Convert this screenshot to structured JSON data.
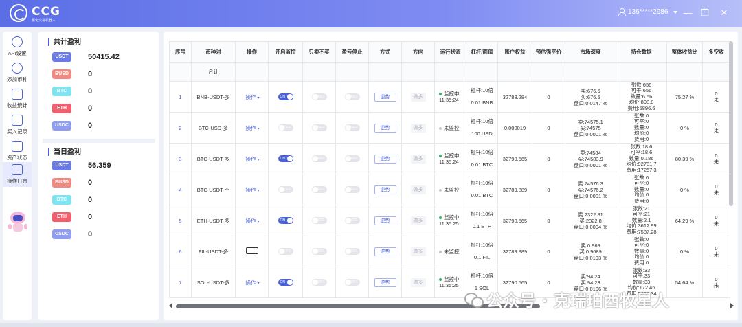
{
  "header": {
    "logo_text": "CCG",
    "logo_sub": "量化交易机器人",
    "user": "136*****2986",
    "window": {
      "minimize": "—",
      "restore": "❐",
      "close": "✕"
    }
  },
  "sidebar": {
    "items": [
      {
        "label": "API设置",
        "icon": "gear-icon"
      },
      {
        "label": "添加币种",
        "icon": "add-coin-icon"
      },
      {
        "label": "收益统计",
        "icon": "chart-icon"
      },
      {
        "label": "买入记录",
        "icon": "record-icon"
      },
      {
        "label": "资产状态",
        "icon": "wallet-icon"
      },
      {
        "label": "操作日志",
        "icon": "log-icon"
      }
    ]
  },
  "profit": {
    "total_title": "共计盈利",
    "today_title": "当日盈利",
    "total": [
      {
        "coin": "USDT",
        "value": "50415.42",
        "color": "#6a7be8"
      },
      {
        "coin": "BUSD",
        "value": "0",
        "color": "#f08a80"
      },
      {
        "coin": "BTC",
        "value": "0",
        "color": "#7fe3f0"
      },
      {
        "coin": "ETH",
        "value": "0",
        "color": "#f05f6e"
      },
      {
        "coin": "USDC",
        "value": "0",
        "color": "#8f9cf0"
      }
    ],
    "today": [
      {
        "coin": "USDT",
        "value": "56.359",
        "color": "#6a7be8"
      },
      {
        "coin": "BUSD",
        "value": "0",
        "color": "#f08a80"
      },
      {
        "coin": "BTC",
        "value": "0",
        "color": "#7fe3f0"
      },
      {
        "coin": "ETH",
        "value": "0",
        "color": "#f05f6e"
      },
      {
        "coin": "USDC",
        "value": "0",
        "color": "#8f9cf0"
      }
    ]
  },
  "table": {
    "headers": [
      "序号",
      "币种对",
      "操作",
      "开启监控",
      "只卖不买",
      "盈亏停止",
      "方式",
      "方向",
      "运行状态",
      "杠杆/面值",
      "账户权益",
      "预估强平价",
      "市场深度",
      "持仓数据",
      "整体收益比",
      "多空收"
    ],
    "summary_label": "合计",
    "rows": [
      {
        "idx": "1",
        "pair": "BNB-USDT-多",
        "op": "操作",
        "monitor": "ON",
        "sell_only": "OFF",
        "stop": "OFF",
        "mode": "逆势",
        "dir": "做多",
        "status": "监控中",
        "status_time": "11:35:24",
        "running": true,
        "lev": "杠杆:10倍",
        "face": "0.01 BNB",
        "equity": "32788.284",
        "liq": "0",
        "depth": [
          "卖:676.6",
          "买:676.5",
          "盘口:0.0147 %"
        ],
        "pos": [
          "张数:656",
          "可平:656",
          "数量:6.56",
          "均价:898.8",
          "费用:5896.6"
        ],
        "ratio": "75.27 %",
        "ls": [
          "0",
          "未"
        ]
      },
      {
        "idx": "2",
        "pair": "BTC-USD-多",
        "op": "操作",
        "monitor": "OFF",
        "sell_only": "OFF",
        "stop": "OFF",
        "mode": "逆势",
        "dir": "做多",
        "status": "未监控",
        "status_time": "",
        "running": false,
        "lev": "杠杆:10倍",
        "face": "100 USD",
        "equity": "0.000019",
        "liq": "0",
        "depth": [
          "卖:74575.1",
          "买:74575",
          "盘口:0.0001 %"
        ],
        "pos": [
          "张数:0",
          "可平:0",
          "数量:0",
          "均价:0",
          "费用:0"
        ],
        "ratio": "0 %",
        "ls": [
          "0",
          "未"
        ]
      },
      {
        "idx": "3",
        "pair": "BTC-USDT-多",
        "op": "操作",
        "monitor": "ON",
        "sell_only": "OFF",
        "stop": "OFF",
        "mode": "逆势",
        "dir": "做多",
        "status": "监控中",
        "status_time": "11:35:24",
        "running": true,
        "lev": "杠杆:10倍",
        "face": "0.01 BTC",
        "equity": "32790.565",
        "liq": "0",
        "depth": [
          "卖:74584",
          "买:74583.9",
          "盘口:0.0001 %"
        ],
        "pos": [
          "张数:18.6",
          "可平:18.6",
          "数量:0.186",
          "均价:92781.7",
          "费用:17257.3"
        ],
        "ratio": "80.39 %",
        "ls": [
          "0",
          "未"
        ]
      },
      {
        "idx": "4",
        "pair": "BTC-USDT-空",
        "op": "操作",
        "monitor": "OFF",
        "sell_only": "OFF",
        "stop": "OFF",
        "mode": "逆势",
        "dir": "做多",
        "status": "未监控",
        "status_time": "",
        "running": false,
        "lev": "杠杆:10倍",
        "face": "0.01 BTC",
        "equity": "32789.889",
        "liq": "0",
        "depth": [
          "卖:74576.3",
          "买:74576.2",
          "盘口:0.0001 %"
        ],
        "pos": [
          "张数:0",
          "可平:0",
          "数量:0",
          "均价:0",
          "费用:0"
        ],
        "ratio": "0 %",
        "ls": [
          "0",
          "未"
        ]
      },
      {
        "idx": "5",
        "pair": "ETH-USDT-多",
        "op": "操作",
        "monitor": "ON",
        "sell_only": "OFF",
        "stop": "OFF",
        "mode": "逆势",
        "dir": "做多",
        "status": "监控中",
        "status_time": "11:35:25",
        "running": true,
        "lev": "杠杆:10倍",
        "face": "0.1 ETH",
        "equity": "32790.565",
        "liq": "0",
        "depth": [
          "卖:2322.81",
          "买:2322.8",
          "盘口:0.0004 %"
        ],
        "pos": [
          "张数:21",
          "可平:21",
          "数量:2.1",
          "均价:3612.99",
          "费用:7587.28"
        ],
        "ratio": "64.29 %",
        "ls": [
          "0",
          "未"
        ]
      },
      {
        "idx": "6",
        "pair": "FIL-USDT-多",
        "op": "操作",
        "monitor": "OFF",
        "sell_only": "OFF",
        "stop": "OFF",
        "mode": "逆势",
        "dir": "做多",
        "status": "未监控",
        "status_time": "",
        "running": false,
        "lev": "杠杆:10倍",
        "face": "0.1 FIL",
        "equity": "32789.889",
        "liq": "0",
        "depth": [
          "卖:0.969",
          "买:0.9689",
          "盘口:0.0103 %"
        ],
        "pos": [
          "张数:0",
          "可平:0",
          "数量:0",
          "均价:0",
          "费用:0"
        ],
        "ratio": "0 %",
        "ls": [
          "0",
          "未"
        ]
      },
      {
        "idx": "7",
        "pair": "SOL-USDT-多",
        "op": "操作",
        "monitor": "ON",
        "sell_only": "OFF",
        "stop": "OFF",
        "mode": "逆势",
        "dir": "做多",
        "status": "监控中",
        "status_time": "11:35:25",
        "running": true,
        "lev": "杠杆:10倍",
        "face": "1 SOL",
        "equity": "32790.565",
        "liq": "0",
        "depth": [
          "卖:94.24",
          "买:94.23",
          "盘口:0.0106 %"
        ],
        "pos": [
          "张数:33",
          "可平:33",
          "数量:33",
          "均价:172.46",
          "费用:5691.34"
        ],
        "ratio": "54.64 %",
        "ls": [
          "0",
          "未"
        ]
      }
    ]
  },
  "watermark": "公众号 · 克瑞珀西牧星人"
}
